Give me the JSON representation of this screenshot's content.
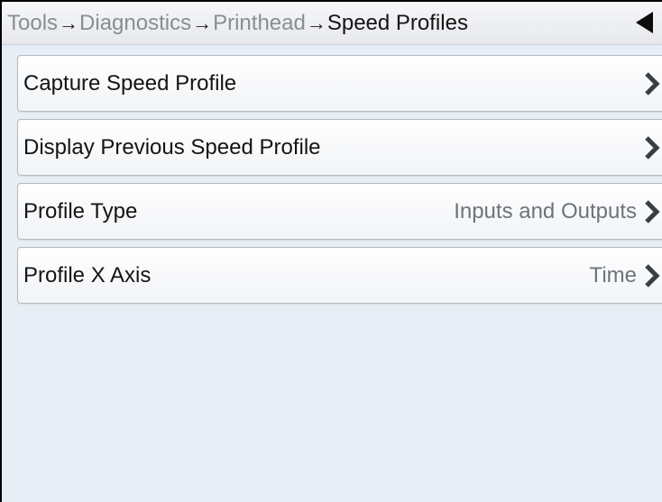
{
  "header": {
    "breadcrumb": [
      {
        "label": "Tools"
      },
      {
        "label": "Diagnostics"
      },
      {
        "label": "Printhead"
      },
      {
        "label": "Speed Profiles"
      }
    ],
    "separator": "→",
    "back_icon": "back-arrow-icon"
  },
  "menu": {
    "items": [
      {
        "label": "Capture Speed Profile",
        "value": "",
        "icon": "chevron-right-icon"
      },
      {
        "label": "Display Previous Speed Profile",
        "value": "",
        "icon": "chevron-right-icon"
      },
      {
        "label": "Profile Type",
        "value": "Inputs and Outputs",
        "icon": "chevron-right-icon"
      },
      {
        "label": "Profile X Axis",
        "value": "Time",
        "icon": "chevron-right-icon"
      }
    ]
  },
  "colors": {
    "background": "#e8eef5",
    "header": "#eceef1",
    "row": "#ffffff",
    "text": "#141414",
    "muted_text": "#8a8d92",
    "value_text": "#6f7378"
  }
}
